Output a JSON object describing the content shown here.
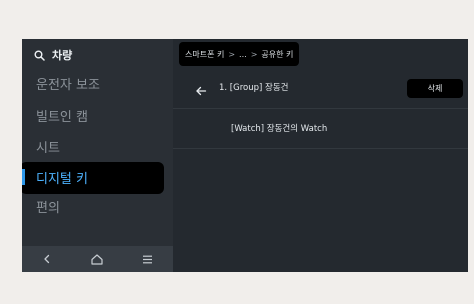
{
  "sidebar": {
    "search_label": "차량",
    "items": [
      {
        "label": "운전자 보조"
      },
      {
        "label": "빌트인 캠"
      },
      {
        "label": "시트"
      },
      {
        "label": "디지털 키"
      },
      {
        "label": "편의"
      }
    ],
    "selected_index": 3
  },
  "bottom_nav": {
    "icons": [
      "back-chevron-icon",
      "home-icon",
      "menu-icon"
    ]
  },
  "breadcrumb": {
    "items": [
      "스마트폰 키",
      "...",
      "공유한 키"
    ],
    "separator": ">"
  },
  "header": {
    "title": "1. [Group] 장동건",
    "delete_label": "삭제"
  },
  "device": {
    "label": "[Watch] 장동건의 Watch"
  },
  "colors": {
    "accent": "#2e98ea",
    "selected_text": "#4db3ff",
    "panel_bg": "#24292f",
    "page_bg": "#f1eeeb"
  }
}
